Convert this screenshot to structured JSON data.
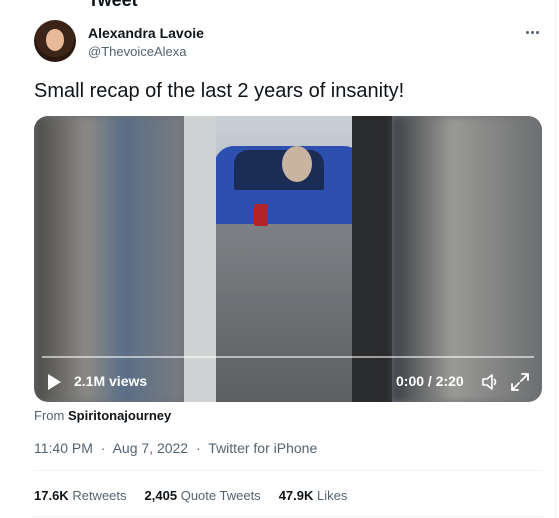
{
  "header_fragment": "Tweet",
  "author": {
    "name": "Alexandra Lavoie",
    "handle": "@ThevoiceAlexa"
  },
  "tweet_text": "Small recap of the last 2 years of insanity!",
  "video": {
    "views": "2.1M views",
    "time": "0:00 / 2:20"
  },
  "source": {
    "label": "From",
    "account": "Spiritonajourney"
  },
  "meta": {
    "time": "11:40 PM",
    "date": "Aug 7, 2022",
    "client": "Twitter for iPhone",
    "sep": "·"
  },
  "stats": {
    "retweets_count": "17.6K",
    "retweets_label": "Retweets",
    "quotes_count": "2,405",
    "quotes_label": "Quote Tweets",
    "likes_count": "47.9K",
    "likes_label": "Likes"
  },
  "colors": {
    "text": "#0f1419",
    "secondary": "#536471",
    "divider": "#eff3f4"
  }
}
